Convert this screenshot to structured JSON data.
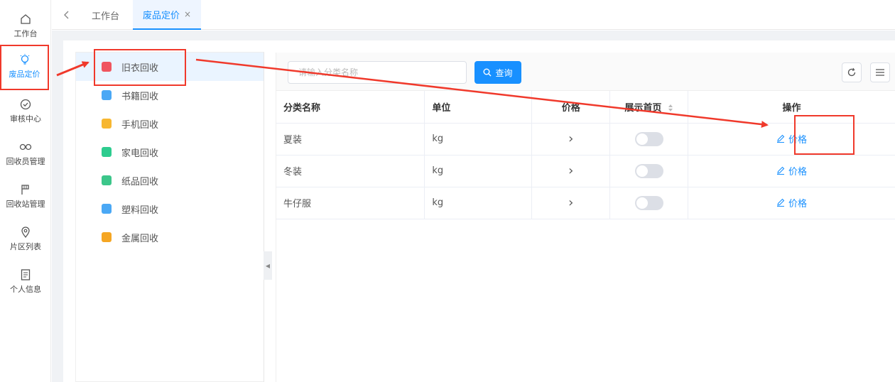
{
  "nav": {
    "items": [
      {
        "label": "工作台",
        "icon": "home-icon"
      },
      {
        "label": "废品定价",
        "icon": "lightbulb-icon"
      },
      {
        "label": "审核中心",
        "icon": "check-circle-icon"
      },
      {
        "label": "回收员管理",
        "icon": "infinity-icon"
      },
      {
        "label": "回收站管理",
        "icon": "flag-icon"
      },
      {
        "label": "片区列表",
        "icon": "location-pin-icon"
      },
      {
        "label": "个人信息",
        "icon": "document-icon"
      }
    ]
  },
  "tabs": {
    "items": [
      {
        "label": "工作台"
      },
      {
        "label": "废品定价",
        "close": "×"
      }
    ]
  },
  "categories": {
    "items": [
      {
        "label": "旧衣回收",
        "icon": "clothes-icon",
        "color": "#f0555f"
      },
      {
        "label": "书籍回收",
        "icon": "book-icon",
        "color": "#4aa8f5"
      },
      {
        "label": "手机回收",
        "icon": "phone-icon",
        "color": "#f7b731"
      },
      {
        "label": "家电回收",
        "icon": "appliance-icon",
        "color": "#2ecc8f"
      },
      {
        "label": "纸品回收",
        "icon": "paper-icon",
        "color": "#3cc68a"
      },
      {
        "label": "塑料回收",
        "icon": "plastic-icon",
        "color": "#4aa8f5"
      },
      {
        "label": "金属回收",
        "icon": "metal-icon",
        "color": "#f5a623"
      }
    ]
  },
  "search": {
    "placeholder": "请输入分类名称",
    "button": "查询"
  },
  "table": {
    "headers": [
      "分类名称",
      "单位",
      "价格",
      "展示首页",
      "操作"
    ],
    "rows": [
      {
        "name": "夏装",
        "unit": "kg",
        "price": "›",
        "op": "价格"
      },
      {
        "name": "冬装",
        "unit": "kg",
        "price": "›",
        "op": "价格"
      },
      {
        "name": "牛仔服",
        "unit": "kg",
        "price": "›",
        "op": "价格"
      }
    ]
  },
  "colors": {
    "accent": "#1890ff",
    "annotation": "#f0392b"
  }
}
